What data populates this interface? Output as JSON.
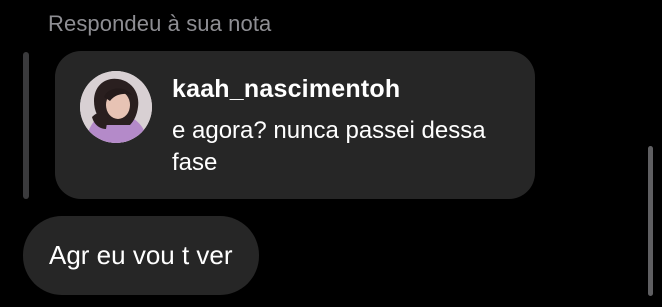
{
  "reply_context": "Respondeu à sua nota",
  "note": {
    "username": "kaah_nascimentoh",
    "text": "e agora? nunca passei dessa fase",
    "avatar_icon": "profile-photo"
  },
  "message": {
    "text": "Agr eu vou t ver"
  },
  "colors": {
    "background": "#000000",
    "bubble": "#262626",
    "secondary_text": "#8e8e93",
    "primary_text": "#ffffff"
  }
}
